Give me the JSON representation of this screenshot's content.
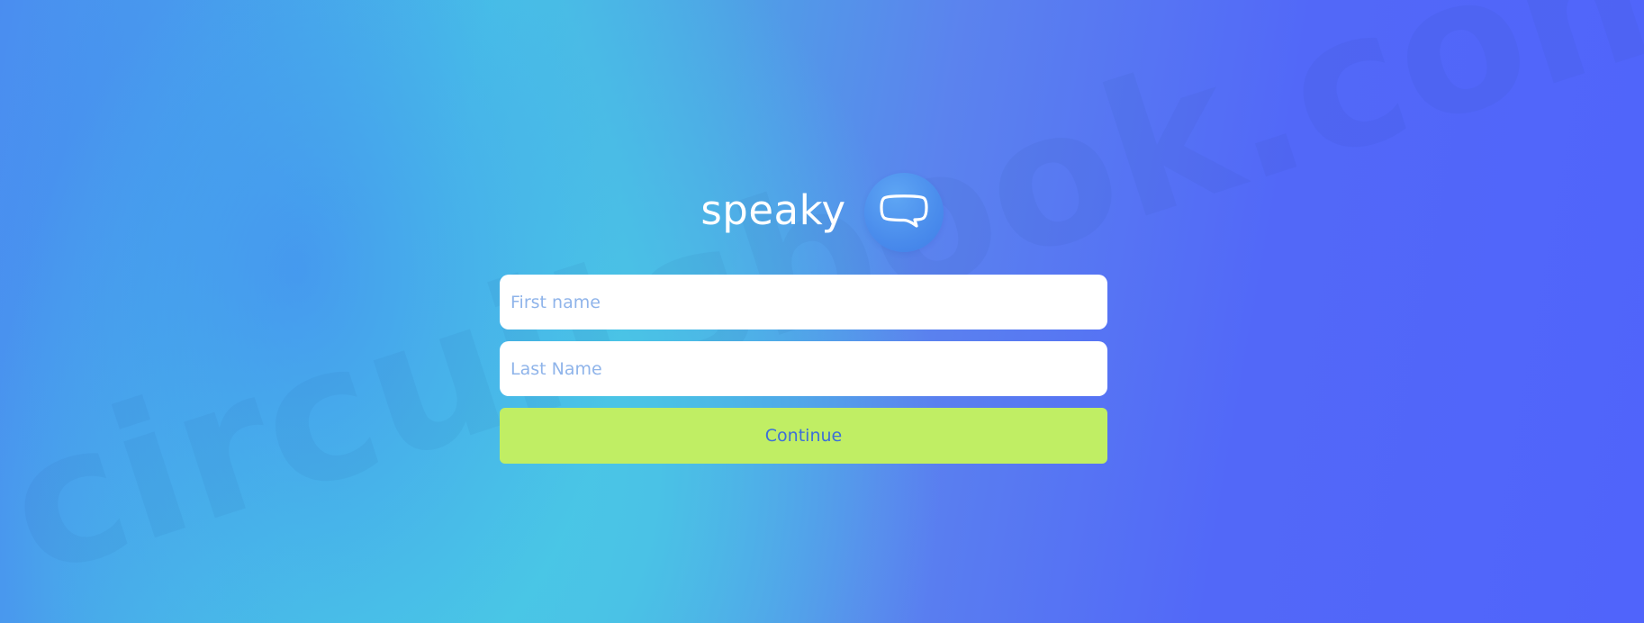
{
  "brand": {
    "name": "speaky",
    "logo_icon": "speech-bubble-icon"
  },
  "form": {
    "first_name_placeholder": "First name",
    "last_name_placeholder": "Last Name",
    "continue_label": "Continue"
  },
  "watermark": {
    "text": "circuitsbook.com"
  },
  "colors": {
    "button_bg": "#c0ee64",
    "button_text": "#3d6fd8",
    "placeholder": "#8fb4ea",
    "background_start": "#46c0e6",
    "background_end": "#5064fb"
  }
}
